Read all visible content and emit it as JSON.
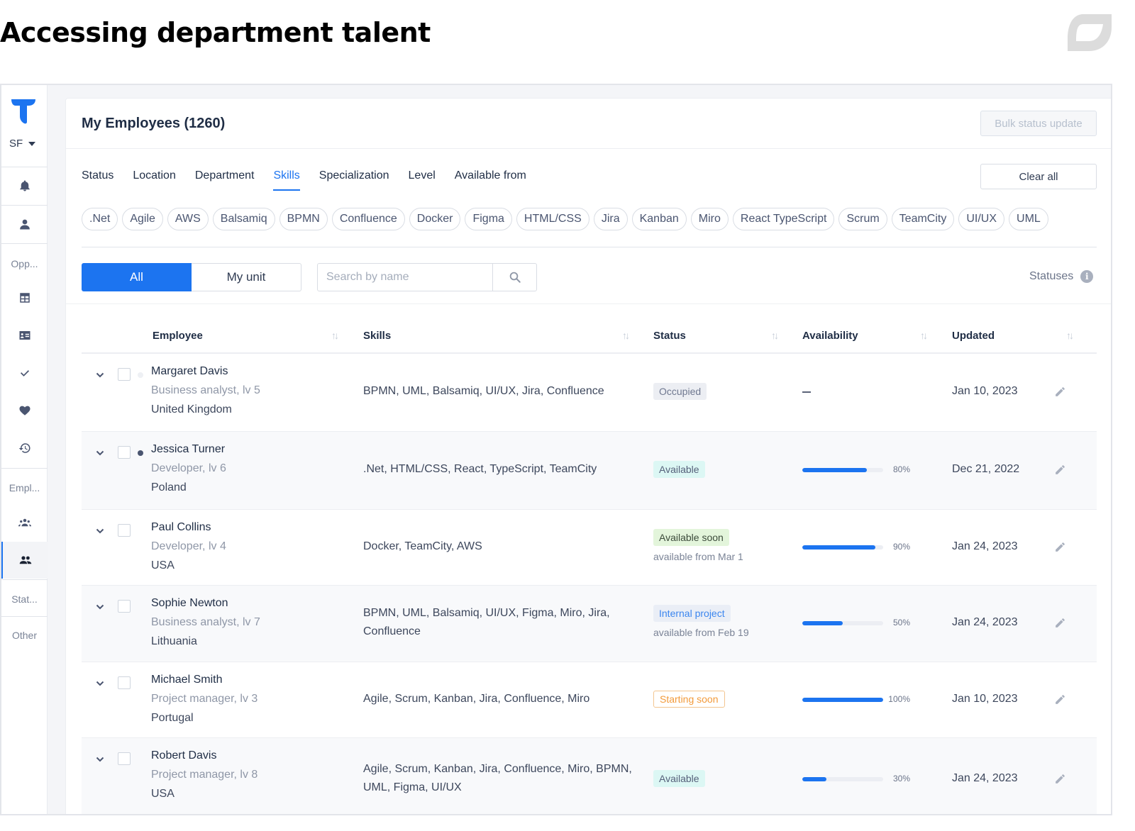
{
  "slide": {
    "title": "Accessing department talent"
  },
  "sidebar": {
    "org_switcher": "SF",
    "section_labels": {
      "opportunities": "Opp...",
      "employees": "Empl...",
      "statistics": "Stat...",
      "other": "Other"
    }
  },
  "header": {
    "title": "My Employees (1260)",
    "bulk_button": "Bulk status update"
  },
  "filters": {
    "tabs": [
      "Status",
      "Location",
      "Department",
      "Skills",
      "Specialization",
      "Level",
      "Available from"
    ],
    "active_tab": "Skills",
    "clear_all": "Clear all",
    "skill_chips": [
      ".Net",
      "Agile",
      "AWS",
      "Balsamiq",
      "BPMN",
      "Confluence",
      "Docker",
      "Figma",
      "HTML/CSS",
      "Jira",
      "Kanban",
      "Miro",
      "React TypeScript",
      "Scrum",
      "TeamCity",
      "UI/UX",
      "UML"
    ]
  },
  "toolbar": {
    "scope_all": "All",
    "scope_my_unit": "My unit",
    "search_placeholder": "Search by name",
    "statuses_label": "Statuses"
  },
  "table": {
    "columns": [
      "Employee",
      "Skills",
      "Status",
      "Availability",
      "Updated"
    ],
    "rows": [
      {
        "name": "Margaret Davis",
        "role": "Business analyst, lv 5",
        "location": "United Kingdom",
        "skills": "BPMN, UML, Balsamiq, UI/UX, Jira, Confluence",
        "status": "Occupied",
        "status_note": "",
        "availability": null,
        "availability_label": "—",
        "updated": "Jan 10, 2023",
        "presence": "offline"
      },
      {
        "name": "Jessica Turner",
        "role": "Developer, lv 6",
        "location": "Poland",
        "skills": ".Net, HTML/CSS, React, TypeScript, TeamCity",
        "status": "Available",
        "status_note": "",
        "availability": 80,
        "availability_label": "80%",
        "updated": "Dec 21, 2022",
        "presence": "online"
      },
      {
        "name": "Paul Collins",
        "role": "Developer, lv 4",
        "location": "USA",
        "skills": "Docker, TeamCity, AWS",
        "status": "Available soon",
        "status_note": "available from Mar 1",
        "availability": 90,
        "availability_label": "90%",
        "updated": "Jan 24, 2023",
        "presence": "none"
      },
      {
        "name": "Sophie Newton",
        "role": "Business analyst, lv 7",
        "location": "Lithuania",
        "skills": "BPMN, UML, Balsamiq, UI/UX, Figma, Miro, Jira, Confluence",
        "status": "Internal project",
        "status_note": "available from Feb 19",
        "availability": 50,
        "availability_label": "50%",
        "updated": "Jan 24, 2023",
        "presence": "none"
      },
      {
        "name": "Michael Smith",
        "role": "Project manager, lv 3",
        "location": "Portugal",
        "skills": "Agile, Scrum, Kanban, Jira, Confluence, Miro",
        "status": "Starting soon",
        "status_note": "",
        "availability": 100,
        "availability_label": "100%",
        "updated": "Jan 10, 2023",
        "presence": "none"
      },
      {
        "name": "Robert Davis",
        "role": "Project manager, lv 8",
        "location": "USA",
        "skills": "Agile, Scrum, Kanban, Jira, Confluence, Miro, BPMN, UML, Figma, UI/UX",
        "status": "Available",
        "status_note": "",
        "availability": 30,
        "availability_label": "30%",
        "updated": "Jan 24, 2023",
        "presence": "none"
      }
    ]
  },
  "colors": {
    "accent": "#1c74f0",
    "text": "#1f2d45",
    "muted": "#8f97a7"
  }
}
